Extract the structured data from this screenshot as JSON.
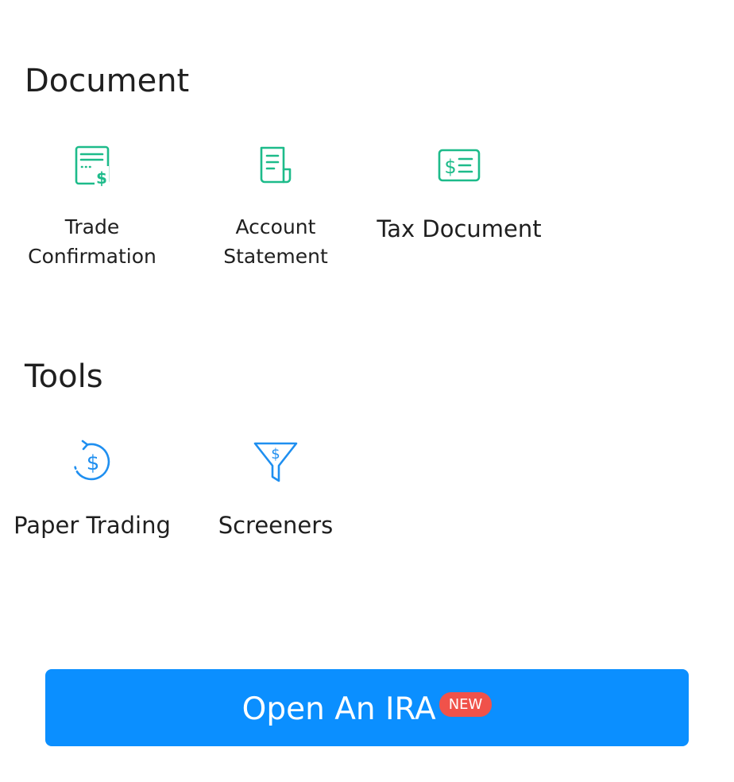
{
  "sections": {
    "document": {
      "title": "Document",
      "items": [
        {
          "label": "Trade\nConfirmation",
          "icon": "receipt-dollar-icon"
        },
        {
          "label": "Account\nStatement",
          "icon": "statement-scroll-icon"
        },
        {
          "label": "Tax Document",
          "icon": "dollar-card-icon"
        }
      ]
    },
    "tools": {
      "title": "Tools",
      "items": [
        {
          "label": "Paper Trading",
          "icon": "dollar-refresh-icon"
        },
        {
          "label": "Screeners",
          "icon": "dollar-funnel-icon"
        }
      ]
    }
  },
  "cta": {
    "label": "Open An IRA",
    "badge": "NEW"
  },
  "colors": {
    "document_icon": "#1dbb8a",
    "tools_icon": "#1f8ff0",
    "cta_background": "#0b8fff",
    "badge_background": "#f0524a",
    "text": "#1f1f1f"
  }
}
